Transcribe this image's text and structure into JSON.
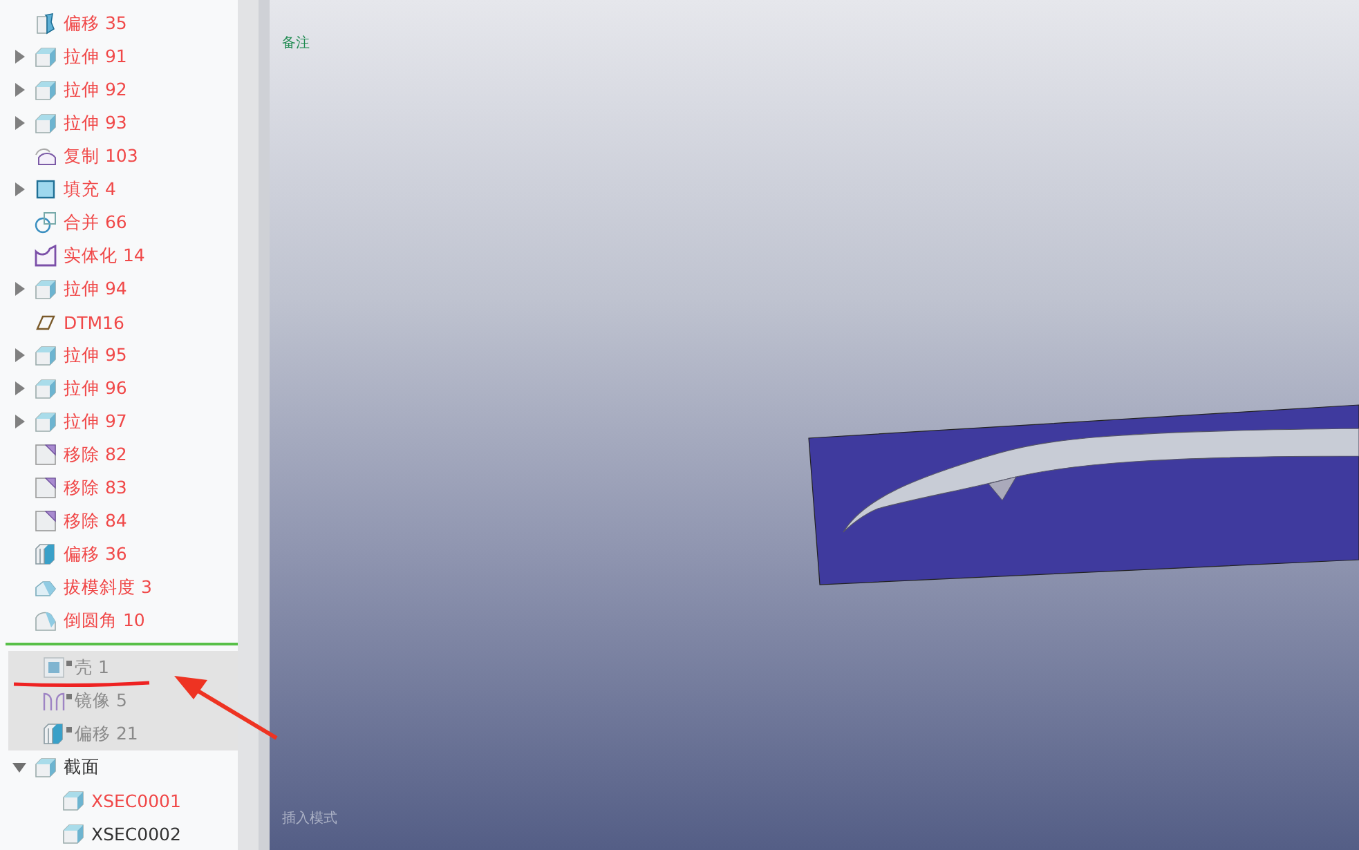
{
  "model_tree": {
    "items": [
      {
        "label": "偏移 35",
        "kind": "offset",
        "expandable": false,
        "error": true,
        "suppressed": false
      },
      {
        "label": "拉伸 91",
        "kind": "extrude",
        "expandable": true,
        "expanded": false,
        "error": true,
        "suppressed": false
      },
      {
        "label": "拉伸 92",
        "kind": "extrude",
        "expandable": true,
        "expanded": false,
        "error": true,
        "suppressed": false
      },
      {
        "label": "拉伸 93",
        "kind": "extrude",
        "expandable": true,
        "expanded": false,
        "error": true,
        "suppressed": false
      },
      {
        "label": "复制 103",
        "kind": "copy",
        "expandable": false,
        "error": true,
        "suppressed": false
      },
      {
        "label": "填充 4",
        "kind": "fill",
        "expandable": true,
        "expanded": false,
        "error": true,
        "suppressed": false
      },
      {
        "label": "合并 66",
        "kind": "merge",
        "expandable": false,
        "error": true,
        "suppressed": false
      },
      {
        "label": "实体化 14",
        "kind": "solidify",
        "expandable": false,
        "error": true,
        "suppressed": false
      },
      {
        "label": "拉伸 94",
        "kind": "extrude",
        "expandable": true,
        "expanded": false,
        "error": true,
        "suppressed": false
      },
      {
        "label": "DTM16",
        "kind": "datum",
        "expandable": false,
        "error": true,
        "suppressed": false
      },
      {
        "label": "拉伸 95",
        "kind": "extrude",
        "expandable": true,
        "expanded": false,
        "error": true,
        "suppressed": false
      },
      {
        "label": "拉伸 96",
        "kind": "extrude",
        "expandable": true,
        "expanded": false,
        "error": true,
        "suppressed": false
      },
      {
        "label": "拉伸 97",
        "kind": "extrude",
        "expandable": true,
        "expanded": false,
        "error": true,
        "suppressed": false
      },
      {
        "label": "移除 82",
        "kind": "remove",
        "expandable": false,
        "error": true,
        "suppressed": false
      },
      {
        "label": "移除 83",
        "kind": "remove",
        "expandable": false,
        "error": true,
        "suppressed": false
      },
      {
        "label": "移除 84",
        "kind": "remove",
        "expandable": false,
        "error": true,
        "suppressed": false
      },
      {
        "label": "偏移 36",
        "kind": "thicken",
        "expandable": false,
        "error": true,
        "suppressed": false
      },
      {
        "label": "拔模斜度 3",
        "kind": "draft",
        "expandable": false,
        "error": true,
        "suppressed": false
      },
      {
        "label": "倒圆角 10",
        "kind": "round",
        "expandable": false,
        "error": true,
        "suppressed": false
      },
      {
        "kind": "insert"
      },
      {
        "label": "壳 1",
        "kind": "shell",
        "expandable": false,
        "error": false,
        "suppressed": true
      },
      {
        "label": "镜像 5",
        "kind": "mirror",
        "expandable": false,
        "error": false,
        "suppressed": true
      },
      {
        "label": "偏移 21",
        "kind": "thicken",
        "expandable": false,
        "error": false,
        "suppressed": true
      },
      {
        "label": "截面",
        "kind": "section",
        "expandable": true,
        "expanded": true,
        "error": false,
        "suppressed": false,
        "children": [
          {
            "label": "XSEC0001",
            "kind": "section",
            "expandable": false,
            "error": true,
            "suppressed": false
          },
          {
            "label": "XSEC0002",
            "kind": "section",
            "expandable": false,
            "error": false,
            "suppressed": false
          }
        ]
      }
    ]
  },
  "viewport": {
    "note_label": "备注",
    "status": "插入模式"
  }
}
